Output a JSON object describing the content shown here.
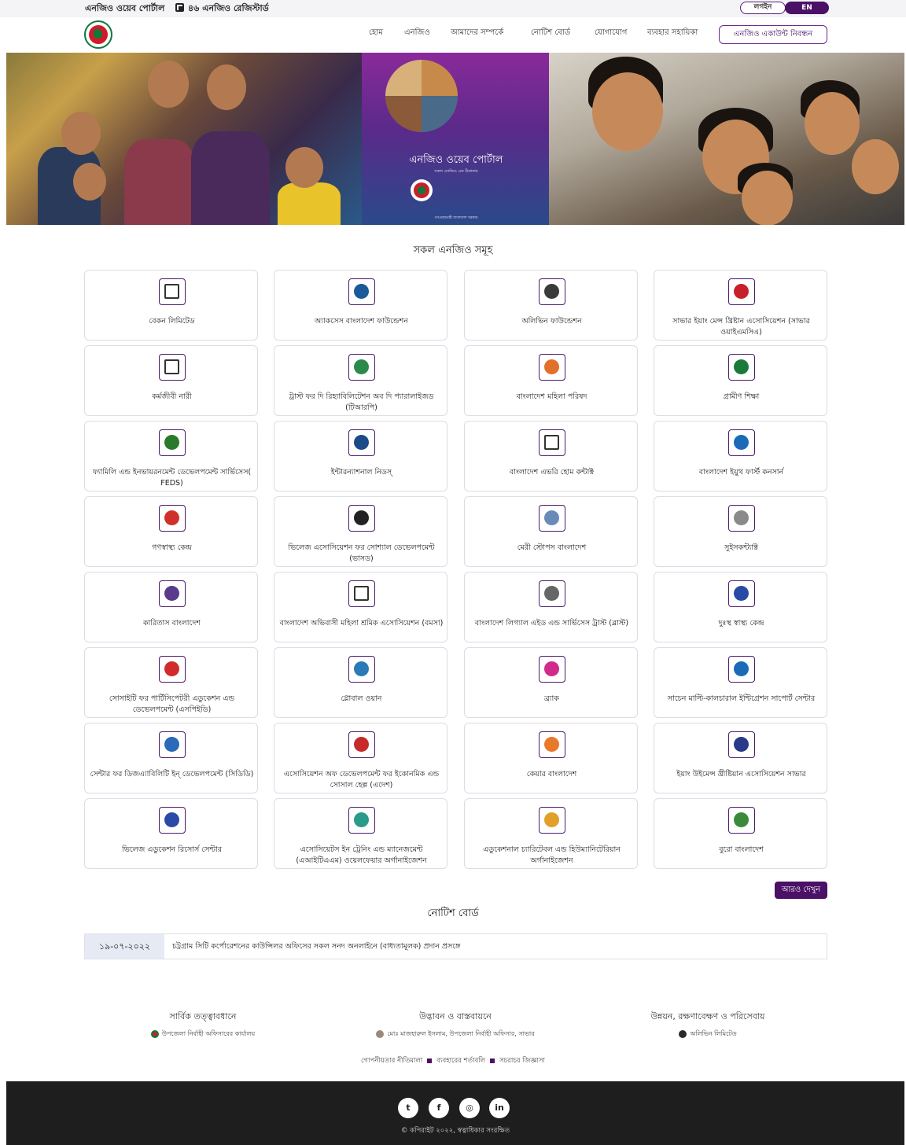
{
  "topbar": {
    "site_name": "এনজিও ওয়েব পোর্টাল",
    "registered_count": "৪৬ এনজিও রেজিস্টার্ড",
    "login_label": "লগইন",
    "language_label": "EN"
  },
  "nav": {
    "items": [
      "হোম",
      "এনজিও",
      "আমাদের সম্পর্কে",
      "নোটিশ বোর্ড",
      "যোগাযোগ",
      "ব্যবহার সহায়িকা"
    ],
    "register_button": "এনজিও একাউন্ট নিবন্ধন"
  },
  "banner": {
    "title": "এনজিও ওয়েব পোর্টাল",
    "subtitle": "সকল এনজিও এক ঠিকানায়",
    "govt_text": "গণপ্রজাতন্ত্রী বাংলাদেশ সরকার"
  },
  "ngo_section": {
    "title": "সকল এনজিও সমূহ",
    "more_button": "আরও দেখুন",
    "items": [
      {
        "name": "বেকন লিমিটেড",
        "icon": "image-placeholder-icon",
        "color": "#444444"
      },
      {
        "name": "অ্যাকসেস বাংলাদেশ ফাউন্ডেশন",
        "icon": "access-bangladesh-logo",
        "color": "#1a5a9a"
      },
      {
        "name": "অলিভিন ফাউন্ডেশন",
        "icon": "olivine-logo",
        "color": "#3a3a3a"
      },
      {
        "name": "সাভার ইয়াং মেন্স খ্রিষ্টান এসোসিয়েশন (সাভার ওয়াইএমসিএ)",
        "icon": "ymca-logo",
        "color": "#c8202a"
      },
      {
        "name": "কর্মজীবী নারী",
        "icon": "image-placeholder-icon",
        "color": "#444444"
      },
      {
        "name": "ট্রাস্ট ফর দি রিহ্যাবিলিটেশন অব দি প্যারালাইজড (টিআরপি)",
        "icon": "crp-logo",
        "color": "#2a8a4a"
      },
      {
        "name": "বাংলাদেশ মহিলা পরিষদ",
        "icon": "mohila-parishad-logo",
        "color": "#e0702a"
      },
      {
        "name": "গ্রামীণ শিক্ষা",
        "icon": "grameen-shikkha-logo",
        "color": "#1a7a3a"
      },
      {
        "name": "ফ্যামিলি এন্ড ইনভায়রনমেন্ট ডেভেলপমেন্ট সার্ভিসেস( FEDS)",
        "icon": "feds-logo",
        "color": "#2a7a2a"
      },
      {
        "name": "ইন্টারন্যাশনাল নিডস্‌",
        "icon": "international-needs-logo",
        "color": "#1a4a8a"
      },
      {
        "name": "বাংলাদেশ এভরি হোম কন্টাক্ট",
        "icon": "image-placeholder-icon",
        "color": "#444444"
      },
      {
        "name": "বাংলাদেশ ইয়ুথ ফার্স্ট কনসার্ন",
        "icon": "byfc-logo",
        "color": "#1a6ab8"
      },
      {
        "name": "গণস্বাস্থ্য কেন্দ্র",
        "icon": "gonoshasthaya-logo",
        "color": "#d0302a"
      },
      {
        "name": "ভিলেজ এসোসিয়েশন ফর সোশ্যাল ডেভেলপমেন্ট (ভাসড)",
        "icon": "vasd-logo",
        "color": "#222222"
      },
      {
        "name": "মেরী স্টোপস বাংলাদেশ",
        "icon": "marie-stopes-logo",
        "color": "#6a8ab8"
      },
      {
        "name": "সুইসকন্ট্যাক্ট",
        "icon": "swisscontact-logo",
        "color": "#8a8a8a"
      },
      {
        "name": "কারিতাস বাংলাদেশ",
        "icon": "caritas-logo",
        "color": "#5a3a8a"
      },
      {
        "name": "বাংলাদেশ অভিবাসী মহিলা শ্রমিক এসোসিয়েশন (বমসা)",
        "icon": "image-placeholder-icon",
        "color": "#444444"
      },
      {
        "name": "বাংলাদেশ লিগ্যাল এইড এন্ড সার্ভিসেস ট্রাস্ট (ব্লাস্ট)",
        "icon": "blast-logo",
        "color": "#666666"
      },
      {
        "name": "দুঃস্থ স্বাস্থ্য কেন্দ্র",
        "icon": "dsk-logo",
        "color": "#2a4aa8"
      },
      {
        "name": "সোসাইটি ফর পার্টিসিপেটরী এডুকেশন এন্ড ডেভেলপমেন্ট (এসপিইডি)",
        "icon": "sped-logo",
        "color": "#d02a2a"
      },
      {
        "name": "গ্লোবাল ওয়ান",
        "icon": "global-one-logo",
        "color": "#2a7ab8"
      },
      {
        "name": "ব্র্যাক",
        "icon": "brac-logo",
        "color": "#d02a8a"
      },
      {
        "name": "সাচেন মাল্টি-কালচারাল ইন্টিগ্রেশন সাপোর্ট সেন্টার",
        "icon": "smc-logo",
        "color": "#1a6ab8"
      },
      {
        "name": "সেন্টার ফর ডিজএ্যাবিলিটি ইন্ ডেভেলপমেন্ট (সিডিডি)",
        "icon": "cdd-logo",
        "color": "#2a6ab8"
      },
      {
        "name": "এসোসিয়েশন অফ ডেভেলপমেন্ট ফর ইকোনমিক এন্ড সোসাল হেল্প (এদেশ)",
        "icon": "adesh-logo",
        "color": "#c82a2a"
      },
      {
        "name": "কেয়ার বাংলাদেশ",
        "icon": "care-logo",
        "color": "#e8782a"
      },
      {
        "name": "ইয়াং উইমেন্স খ্রীষ্টিয়ান এসোসিয়েশন সাভার",
        "icon": "ywca-logo",
        "color": "#2a3a8a"
      },
      {
        "name": "ভিলেজ এডুকেশন রিসোর্স সেন্টার",
        "icon": "verc-logo",
        "color": "#2a4aa8"
      },
      {
        "name": "এসোসিয়েটস ইন ট্রেনিং এন্ড ম্যানেজমেন্ট (এআইটিএএম) ওয়েলফেয়ার অর্গানাইজেশন",
        "icon": "aitam-logo",
        "color": "#2a9a8a"
      },
      {
        "name": "এডুকেশনাল চ্যারিটেবল এন্ড হিউম্যানিটেরিয়ান অর্গানাইজেশন",
        "icon": "echo-logo",
        "color": "#e0a02a"
      },
      {
        "name": "বুরো বাংলাদেশ",
        "icon": "buro-logo",
        "color": "#3a8a3a"
      }
    ]
  },
  "notice_section": {
    "title": "নোটিশ বোর্ড",
    "notice": {
      "date": "১৯-০৭-২০২২",
      "text": "চট্টগ্রাম সিটি কর্পোরেশনের কাউন্সিলর অফিসের সকল সনদ অনলাইনে (বাধ্যতামূলক) প্রদান প্রসঙ্গে"
    }
  },
  "credits": {
    "supervision": {
      "title": "সার্বিক তত্ত্বাবধানে",
      "text": "উপজেলা নির্বাহী অফিসারের কার্যালয়"
    },
    "implementation": {
      "title": "উদ্ভাবন ও বাস্তবায়নে",
      "text": "মোঃ মাজহারুল ইসলাম, উপজেলা নির্বাহী অফিসার, সাভার"
    },
    "maintenance": {
      "title": "উন্নয়ন, রক্ষণাবেক্ষণ ও পরিসেবায়",
      "text": "অলিভিন লিমিটেড"
    }
  },
  "footer_links": [
    "গোপনীয়তার নীতিমালা",
    "ব্যবহারের শর্তাবলি",
    "সচরাচর জিজ্ঞাসা"
  ],
  "footer": {
    "social": [
      {
        "icon": "twitter-icon",
        "glyph": "t"
      },
      {
        "icon": "facebook-icon",
        "glyph": "f"
      },
      {
        "icon": "instagram-icon",
        "glyph": "◎"
      },
      {
        "icon": "linkedin-icon",
        "glyph": "in"
      }
    ],
    "copyright": "© কপিরাইট ২০২২, স্বত্বাধিকার সংরক্ষিত"
  },
  "colors": {
    "primary": "#4a1166",
    "footer_bg": "#1e1e1e",
    "notice_date_bg": "#e6eaf4"
  }
}
